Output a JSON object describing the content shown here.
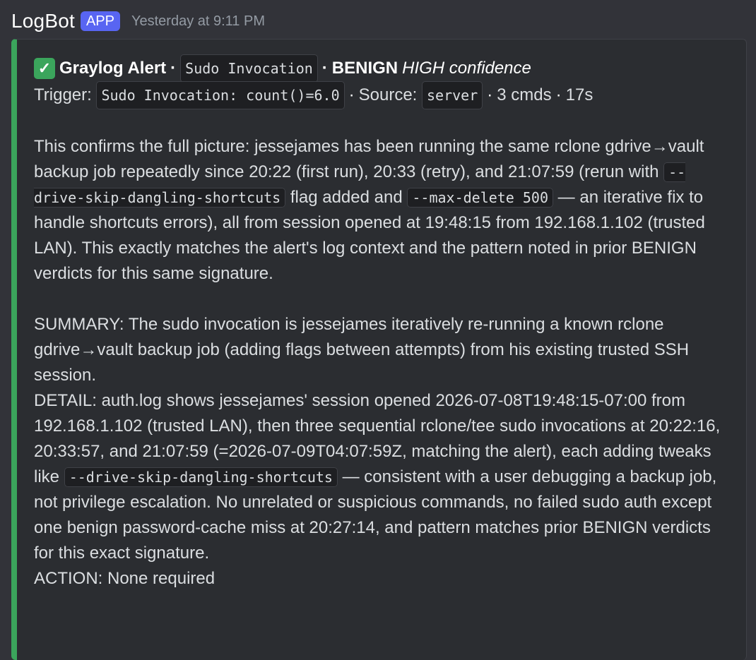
{
  "message": {
    "author": "LogBot",
    "badge": "APP",
    "timestamp": "Yesterday at 9:11 PM"
  },
  "embed": {
    "accent_color": "#3ba55c",
    "title": {
      "icon": "check-icon",
      "label": "Graylog Alert",
      "signature": "Sudo Invocation",
      "verdict": "BENIGN",
      "confidence": "HIGH confidence"
    },
    "trigger": {
      "label": "Trigger:",
      "query": "Sudo Invocation: count()=6.0",
      "source_label": "Source:",
      "source": "server",
      "cmds": "3 cmds",
      "duration": "17s"
    },
    "analysis": {
      "p1": "This confirms the full picture: jessejames has been running the same rclone gdrive→vault backup job repeatedly since 20:22 (first run), 20:33 (retry), and 21:07:59 (rerun with ",
      "code1": "--drive-skip-dangling-shortcuts",
      "p2": " flag added and ",
      "code2": "--max-delete 500",
      "p3": " — an iterative fix to handle shortcuts errors), all from session opened at 19:48:15 from 192.168.1.102 (trusted LAN). This exactly matches the alert's log context and the pattern noted in prior BENIGN verdicts for this same signature."
    },
    "summary": "SUMMARY: The sudo invocation is jessejames iteratively re-running a known rclone gdrive→vault backup job (adding flags between attempts) from his existing trusted SSH session.",
    "detail": {
      "d1": "DETAIL: auth.log shows jessejames' session opened 2026-07-08T19:48:15-07:00 from 192.168.1.102 (trusted LAN), then three sequential rclone/tee sudo invocations at 20:22:16, 20:33:57, and 21:07:59 (=2026-07-09T04:07:59Z, matching the alert), each adding tweaks like ",
      "code": "--drive-skip-dangling-shortcuts",
      "d2": " — consistent with a user debugging a backup job, not privilege escalation. No unrelated or suspicious commands, no failed sudo auth except one benign password-cache miss at 20:27:14, and pattern matches prior BENIGN verdicts for this exact signature."
    },
    "action": "ACTION: None required"
  }
}
